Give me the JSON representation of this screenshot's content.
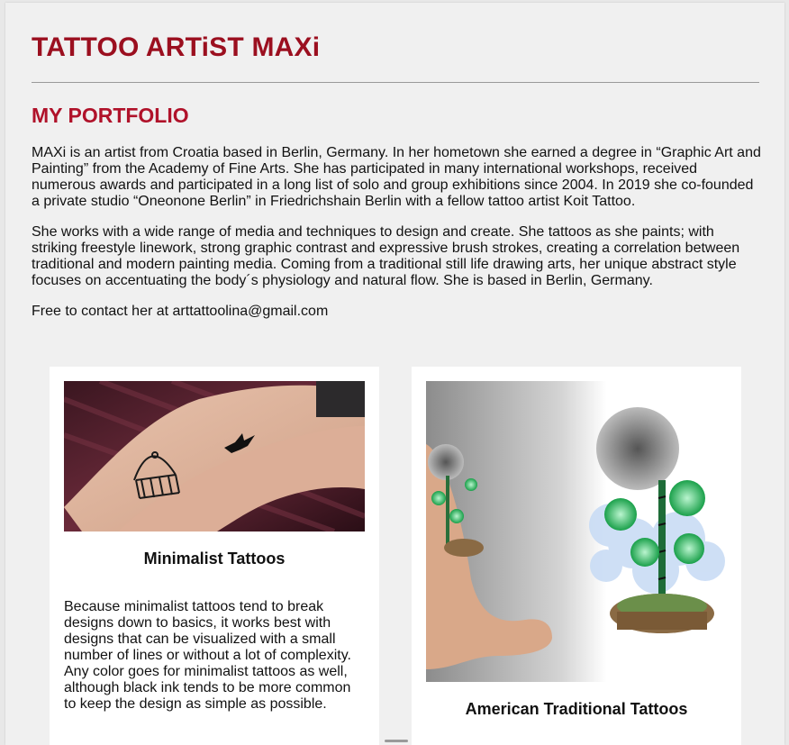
{
  "header": {
    "title": "TATTOO ARTiST MAXi"
  },
  "portfolio": {
    "heading": "MY PORTFOLIO",
    "paragraphs": [
      "MAXi is an artist from Croatia based in Berlin, Germany. In her hometown she earned a degree in “Graphic Art and Painting” from the Academy of Fine Arts. She has participated in many international workshops, received numerous awards and participated in a long list of solo and group exhibitions since 2004. In 2019 she co-founded a private studio “Oneonone Berlin” in Friedrichshain Berlin with a fellow tattoo artist Koit Tattoo.",
      "She works with a wide range of media and techniques to design and create. She tattoos as she paints; with striking freestyle linework, strong graphic contrast and expressive brush strokes, creating a correlation between traditional and modern painting media. Coming from a traditional still life drawing arts, her unique abstract style focuses on accentuating the body´s physiology and natural flow. She is based in Berlin, Germany.",
      "Free to contact her at arttattoolina@gmail.com"
    ]
  },
  "cards": [
    {
      "title": "Minimalist Tattoos",
      "text": "Because minimalist tattoos tend to break designs down to basics, it works best with designs that can be visualized with a small number of lines or without a lot of complexity. Any color goes for minimalist tattoos as well, although black ink tends to be more common to keep the design as simple as possible."
    },
    {
      "title": "American Traditional Tattoos"
    }
  ],
  "colors": {
    "brand": "#9b0f1f",
    "accent": "#b0122a",
    "background": "#f0f0f0",
    "card": "#ffffff"
  }
}
